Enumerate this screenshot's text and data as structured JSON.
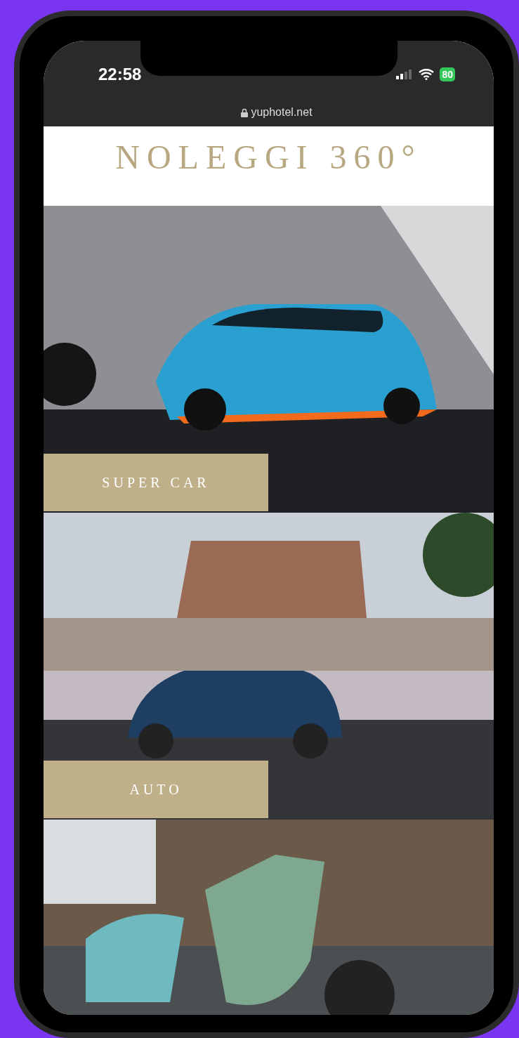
{
  "status_bar": {
    "time": "22:58",
    "battery": "80"
  },
  "address_bar": {
    "url": "yuphotel.net"
  },
  "header": {
    "title": "NOLEGGI 360°"
  },
  "categories": [
    {
      "label": "SUPER CAR",
      "kind": "supercar"
    },
    {
      "label": "AUTO",
      "kind": "car"
    }
  ]
}
